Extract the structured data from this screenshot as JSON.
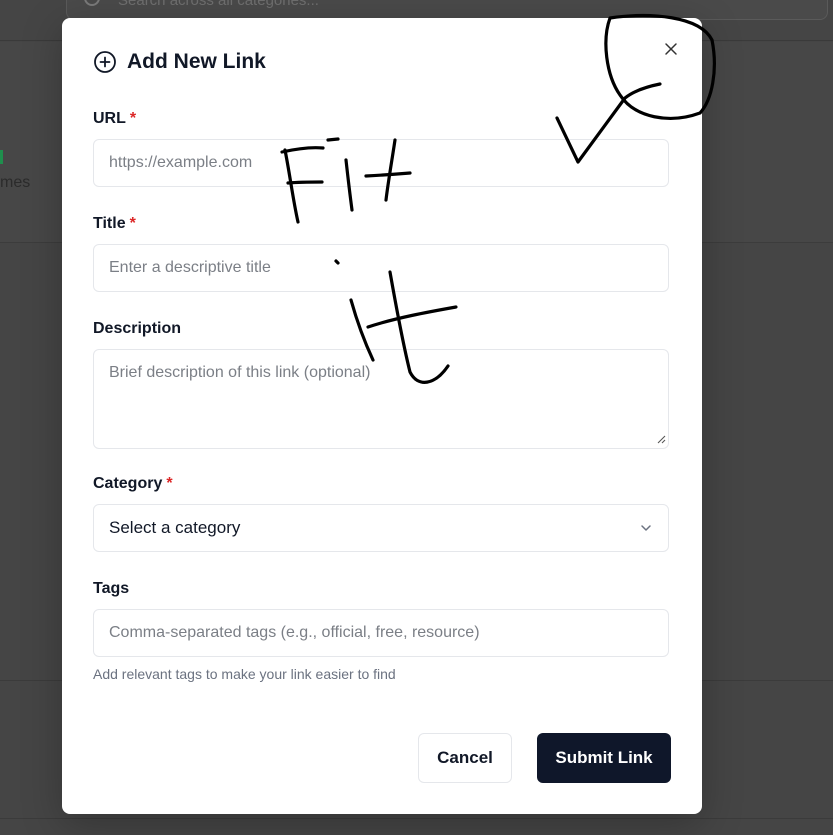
{
  "background": {
    "search_placeholder": "Search across all categories...",
    "card_text": "mes"
  },
  "modal": {
    "title": "Add New Link",
    "fields": {
      "url": {
        "label": "URL",
        "required_mark": "*",
        "placeholder": "https://example.com",
        "value": ""
      },
      "title": {
        "label": "Title",
        "required_mark": "*",
        "placeholder": "Enter a descriptive title",
        "value": ""
      },
      "description": {
        "label": "Description",
        "placeholder": "Brief description of this link (optional)",
        "value": ""
      },
      "category": {
        "label": "Category",
        "required_mark": "*",
        "selected": "Select a category"
      },
      "tags": {
        "label": "Tags",
        "placeholder": "Comma-separated tags (e.g., official, free, resource)",
        "value": "",
        "helper": "Add relevant tags to make your link easier to find"
      }
    },
    "buttons": {
      "cancel": "Cancel",
      "submit": "Submit Link"
    }
  },
  "annotation": {
    "handwriting": "Fit it"
  },
  "colors": {
    "required": "#dc2626",
    "submit_bg": "#0f172a",
    "overlay": "#454545"
  },
  "icons": {
    "title": "plus-circle-icon",
    "close": "close-icon",
    "select": "chevron-down-icon",
    "search": "search-icon"
  }
}
